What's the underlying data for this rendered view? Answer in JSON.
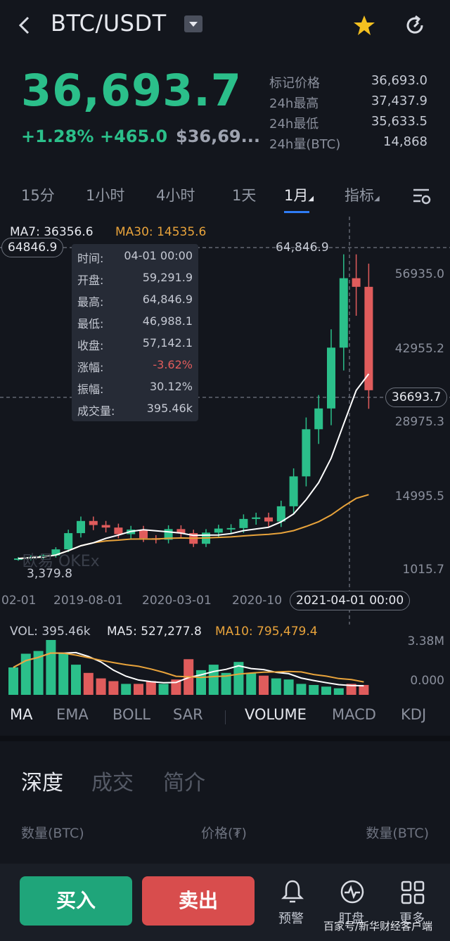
{
  "header": {
    "pair": "BTC/USDT",
    "back_icon": "chevron-left-icon",
    "favorite_icon": "star-icon",
    "refresh_icon": "refresh-icon"
  },
  "ticker": {
    "price": "36,693.7",
    "change_pct": "+1.28%",
    "change_abs": "+465.0",
    "price_usd": "$36,69...",
    "stats": [
      {
        "label": "标记价格",
        "value": "36,693.0"
      },
      {
        "label": "24h最高",
        "value": "37,437.9"
      },
      {
        "label": "24h最低",
        "value": "35,633.5"
      },
      {
        "label": "24h量(BTC)",
        "value": "14,868"
      }
    ]
  },
  "timeframes": [
    "15分",
    "1小时",
    "4小时",
    "1天",
    "1月",
    "指标"
  ],
  "active_timeframe": "1月",
  "chart_data": {
    "type": "candlestick",
    "ma_legend": {
      "ma7": "MA7: 36356.6",
      "ma30": "MA30: 14535.6"
    },
    "y_ticks": [
      "56935.0",
      "42955.2",
      "28975.3",
      "14995.5",
      "1015.7"
    ],
    "x_ticks": [
      "02-01",
      "2019-08-01",
      "2020-03-01",
      "2020-10"
    ],
    "current_price_label": "36693.7",
    "crosshair_price_label": "64846.9",
    "crosshair_date_label": "2021-04-01 00:00",
    "high_label": "64,846.9",
    "low_label": "3,379.8",
    "ylim": [
      1015.7,
      64846.9
    ],
    "candles": [
      {
        "o": 3400,
        "c": 3500
      },
      {
        "o": 3500,
        "c": 3800
      },
      {
        "o": 3800,
        "c": 4100
      },
      {
        "o": 4100,
        "c": 5300
      },
      {
        "o": 5300,
        "c": 8500
      },
      {
        "o": 8500,
        "c": 10900
      },
      {
        "o": 10900,
        "c": 10100
      },
      {
        "o": 10100,
        "c": 9600
      },
      {
        "o": 9600,
        "c": 8300
      },
      {
        "o": 8300,
        "c": 9200
      },
      {
        "o": 9200,
        "c": 7500
      },
      {
        "o": 7500,
        "c": 7200
      },
      {
        "o": 7200,
        "c": 9300
      },
      {
        "o": 9300,
        "c": 8500
      },
      {
        "o": 8500,
        "c": 6400
      },
      {
        "o": 6400,
        "c": 8600
      },
      {
        "o": 8600,
        "c": 9400
      },
      {
        "o": 9400,
        "c": 9500
      },
      {
        "o": 9500,
        "c": 11300
      },
      {
        "o": 11300,
        "c": 11600
      },
      {
        "o": 11600,
        "c": 10800
      },
      {
        "o": 10800,
        "c": 13800
      },
      {
        "o": 13800,
        "c": 19700
      },
      {
        "o": 19700,
        "c": 29000
      },
      {
        "o": 29000,
        "c": 33100
      },
      {
        "o": 33100,
        "c": 45100
      },
      {
        "o": 45100,
        "c": 58800
      },
      {
        "o": 58800,
        "c": 57100
      },
      {
        "o": 57100,
        "c": 36700
      }
    ],
    "volume": {
      "legend": {
        "vol": "VOL: 395.46k",
        "ma5": "MA5: 527,277.8",
        "ma10": "MA10: 795,479.4"
      },
      "y_ticks": [
        "3.38M",
        "0.000"
      ]
    }
  },
  "tooltip": [
    {
      "label": "时间:",
      "value": "04-01 00:00"
    },
    {
      "label": "开盘:",
      "value": "59,291.9"
    },
    {
      "label": "最高:",
      "value": "64,846.9"
    },
    {
      "label": "最低:",
      "value": "46,988.1"
    },
    {
      "label": "收盘:",
      "value": "57,142.1"
    },
    {
      "label": "涨幅:",
      "value": "-3.62%"
    },
    {
      "label": "振幅:",
      "value": "30.12%"
    },
    {
      "label": "成交量:",
      "value": "395.46k"
    }
  ],
  "indicators": [
    "MA",
    "EMA",
    "BOLL",
    "SAR",
    "VOLUME",
    "MACD",
    "KDJ"
  ],
  "sections": [
    "深度",
    "成交",
    "简介"
  ],
  "orderbook_headers": [
    "数量(BTC)",
    "价格(₮)",
    "数量(BTC)"
  ],
  "actions": {
    "buy": "买入",
    "sell": "卖出"
  },
  "bottom_icons": [
    {
      "label": "预警",
      "icon": "bell-icon"
    },
    {
      "label": "盯盘",
      "icon": "pulse-icon"
    },
    {
      "label": "更多",
      "icon": "grid-icon"
    }
  ],
  "watermark": "百家号/新华财经客户端",
  "colors": {
    "up": "#2bbf8a",
    "down": "#e05c5c",
    "ma7": "#ffffff",
    "ma30": "#e8a33b"
  }
}
